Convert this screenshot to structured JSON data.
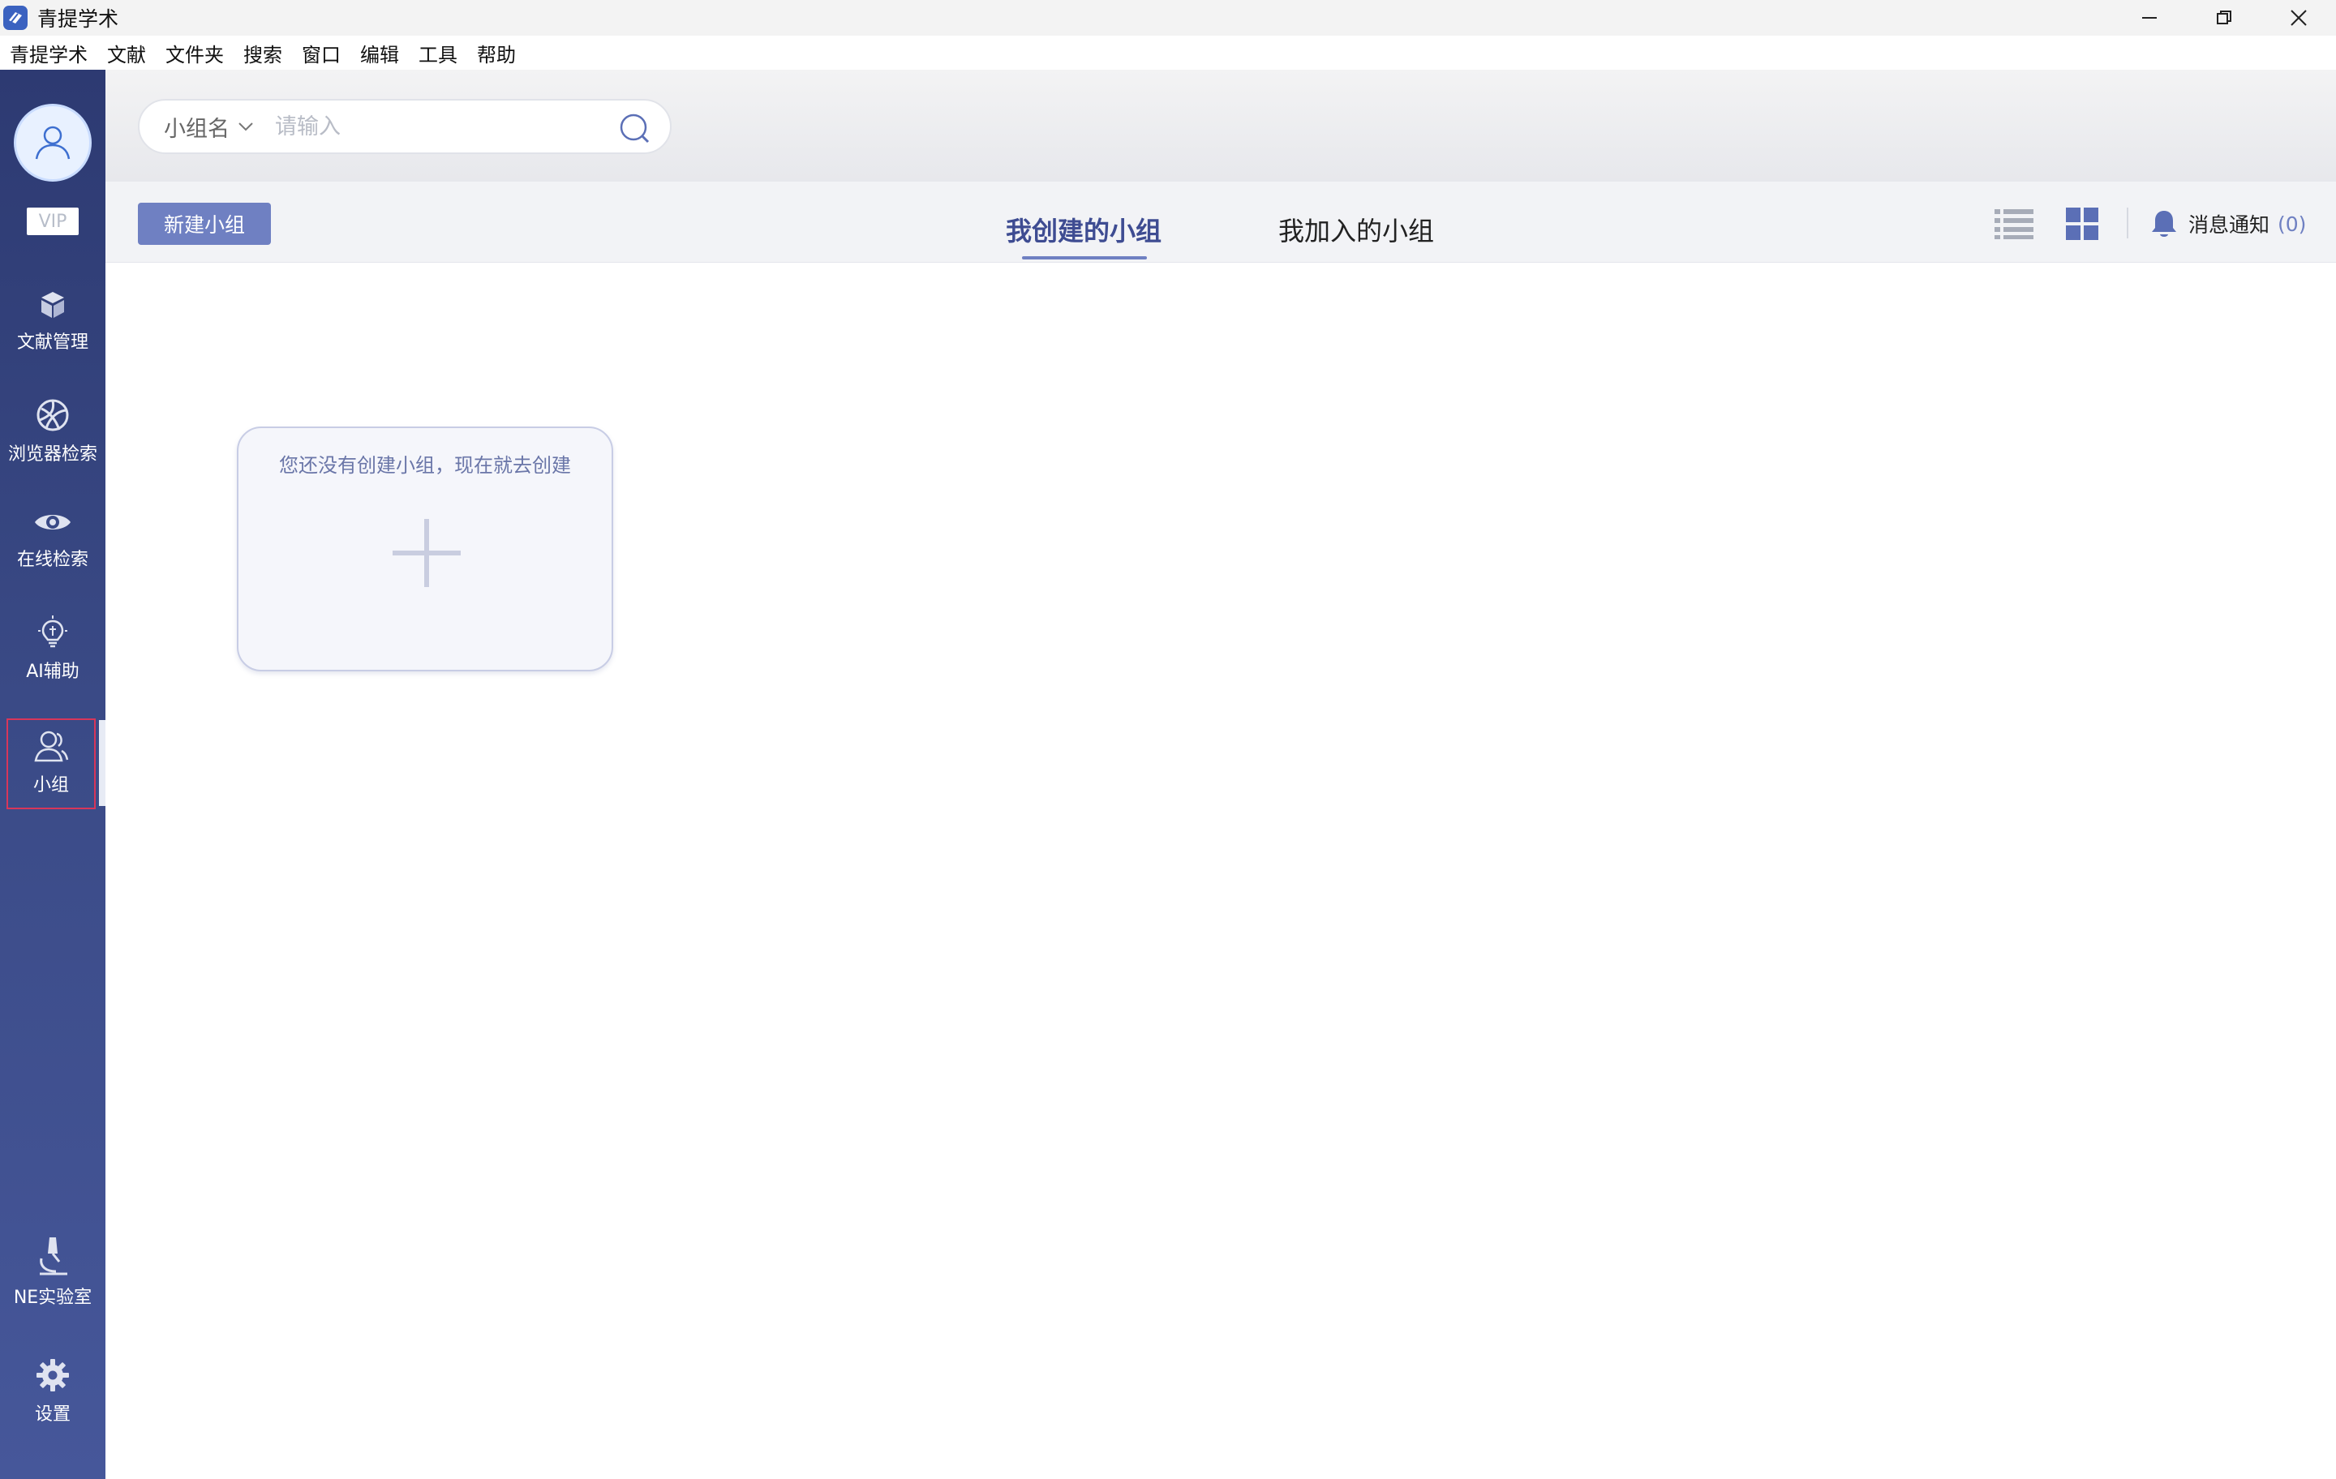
{
  "window": {
    "title": "青提学术",
    "controls": [
      "minimize",
      "restore",
      "close"
    ]
  },
  "menu": [
    "青提学术",
    "文献",
    "文件夹",
    "搜索",
    "窗口",
    "编辑",
    "工具",
    "帮助"
  ],
  "sidebar": {
    "vip_label": "VIP",
    "items": [
      {
        "label": "文献管理",
        "icon": "cube-icon"
      },
      {
        "label": "浏览器检索",
        "icon": "globe-icon"
      },
      {
        "label": "在线检索",
        "icon": "eye-icon"
      },
      {
        "label": "AI辅助",
        "icon": "ai-bulb-icon"
      },
      {
        "label": "小组",
        "icon": "user-group-icon",
        "active": true
      },
      {
        "label": "NE实验室",
        "icon": "microscope-icon"
      },
      {
        "label": "设置",
        "icon": "gear-icon"
      }
    ]
  },
  "search": {
    "scope": "小组名",
    "placeholder": "请输入"
  },
  "toolbar": {
    "new_group_label": "新建小组",
    "tabs": [
      {
        "label": "我创建的小组",
        "active": true
      },
      {
        "label": "我加入的小组",
        "active": false
      }
    ],
    "notify_label": "消息通知",
    "notify_count": "(0)"
  },
  "content": {
    "empty_text": "您还没有创建小组，现在就去创建"
  },
  "colors": {
    "sidebar_top": "#2d3a72",
    "sidebar_bottom": "#46579a",
    "accent": "#6f80c2",
    "active_tab_text": "#3e4c92",
    "active_outline": "#d8365a"
  }
}
